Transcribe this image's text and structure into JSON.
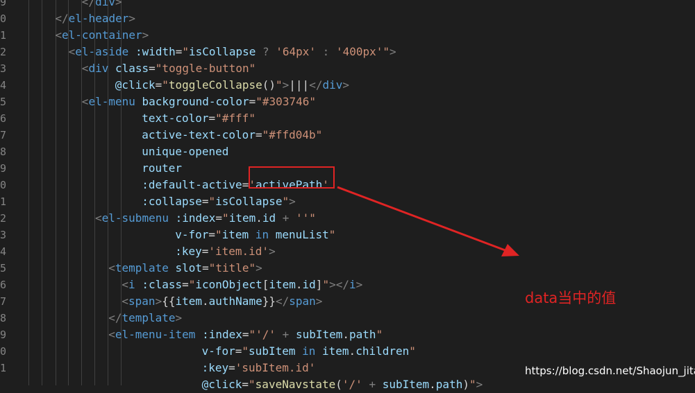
{
  "line_numbers": [
    "9",
    "0",
    "1",
    "2",
    "3",
    "4",
    "5",
    "6",
    "7",
    "8",
    "9",
    "0",
    "1",
    "2",
    "3",
    "4",
    "5",
    "6",
    "7",
    "8",
    "9",
    "0",
    "1"
  ],
  "code_lines": [
    {
      "indent": 6,
      "tokens": [
        {
          "t": "</",
          "c": "punct"
        },
        {
          "t": "div",
          "c": "tag"
        },
        {
          "t": ">",
          "c": "punct"
        }
      ]
    },
    {
      "indent": 4,
      "tokens": [
        {
          "t": "</",
          "c": "punct"
        },
        {
          "t": "el-header",
          "c": "tag"
        },
        {
          "t": ">",
          "c": "punct"
        }
      ]
    },
    {
      "indent": 4,
      "tokens": [
        {
          "t": "<",
          "c": "punct"
        },
        {
          "t": "el-container",
          "c": "tag"
        },
        {
          "t": ">",
          "c": "punct"
        }
      ]
    },
    {
      "indent": 5,
      "tokens": [
        {
          "t": "<",
          "c": "punct"
        },
        {
          "t": "el-aside",
          "c": "tag"
        },
        {
          "t": " ",
          "c": "plain"
        },
        {
          "t": ":width",
          "c": "bind"
        },
        {
          "t": "=",
          "c": "plain"
        },
        {
          "t": "\"",
          "c": "str"
        },
        {
          "t": "isCollapse",
          "c": "attr"
        },
        {
          "t": " ? ",
          "c": "punct"
        },
        {
          "t": "'64px'",
          "c": "str"
        },
        {
          "t": " : ",
          "c": "punct"
        },
        {
          "t": "'400px'",
          "c": "str"
        },
        {
          "t": "\"",
          "c": "str"
        },
        {
          "t": ">",
          "c": "punct"
        }
      ]
    },
    {
      "indent": 6,
      "tokens": [
        {
          "t": "<",
          "c": "punct"
        },
        {
          "t": "div",
          "c": "tag"
        },
        {
          "t": " ",
          "c": "plain"
        },
        {
          "t": "class",
          "c": "attr"
        },
        {
          "t": "=",
          "c": "plain"
        },
        {
          "t": "\"toggle-button\"",
          "c": "str"
        }
      ]
    },
    {
      "indent": 8.5,
      "tokens": [
        {
          "t": "@click",
          "c": "bind"
        },
        {
          "t": "=",
          "c": "plain"
        },
        {
          "t": "\"",
          "c": "str"
        },
        {
          "t": "toggleCollapse",
          "c": "func"
        },
        {
          "t": "()",
          "c": "plain"
        },
        {
          "t": "\"",
          "c": "str"
        },
        {
          "t": ">",
          "c": "punct"
        },
        {
          "t": "|||",
          "c": "plain"
        },
        {
          "t": "</",
          "c": "punct"
        },
        {
          "t": "div",
          "c": "tag"
        },
        {
          "t": ">",
          "c": "punct"
        }
      ]
    },
    {
      "indent": 6,
      "tokens": [
        {
          "t": "<",
          "c": "punct"
        },
        {
          "t": "el-menu",
          "c": "tag"
        },
        {
          "t": " ",
          "c": "plain"
        },
        {
          "t": "background-color",
          "c": "attr"
        },
        {
          "t": "=",
          "c": "plain"
        },
        {
          "t": "\"#303746\"",
          "c": "str"
        }
      ]
    },
    {
      "indent": 10.5,
      "tokens": [
        {
          "t": "text-color",
          "c": "attr"
        },
        {
          "t": "=",
          "c": "plain"
        },
        {
          "t": "\"#fff\"",
          "c": "str"
        }
      ]
    },
    {
      "indent": 10.5,
      "tokens": [
        {
          "t": "active-text-color",
          "c": "attr"
        },
        {
          "t": "=",
          "c": "plain"
        },
        {
          "t": "\"#ffd04b\"",
          "c": "str"
        }
      ]
    },
    {
      "indent": 10.5,
      "tokens": [
        {
          "t": "unique-opened",
          "c": "attr"
        }
      ]
    },
    {
      "indent": 10.5,
      "tokens": [
        {
          "t": "router",
          "c": "attr"
        }
      ]
    },
    {
      "indent": 10.5,
      "tokens": [
        {
          "t": ":default-active",
          "c": "bind"
        },
        {
          "t": "=",
          "c": "plain"
        },
        {
          "t": "'",
          "c": "str"
        },
        {
          "t": "activePath",
          "c": "attr"
        },
        {
          "t": "'",
          "c": "str"
        }
      ]
    },
    {
      "indent": 10.5,
      "tokens": [
        {
          "t": ":collapse",
          "c": "bind"
        },
        {
          "t": "=",
          "c": "plain"
        },
        {
          "t": "\"",
          "c": "str"
        },
        {
          "t": "isCollapse",
          "c": "attr"
        },
        {
          "t": "\"",
          "c": "str"
        },
        {
          "t": ">",
          "c": "punct"
        }
      ]
    },
    {
      "indent": 7,
      "tokens": [
        {
          "t": "<",
          "c": "punct"
        },
        {
          "t": "el-submenu",
          "c": "tag"
        },
        {
          "t": " ",
          "c": "plain"
        },
        {
          "t": ":index",
          "c": "bind"
        },
        {
          "t": "=",
          "c": "plain"
        },
        {
          "t": "\"",
          "c": "str"
        },
        {
          "t": "item",
          "c": "attr"
        },
        {
          "t": ".",
          "c": "plain"
        },
        {
          "t": "id",
          "c": "attr"
        },
        {
          "t": " + ",
          "c": "punct"
        },
        {
          "t": "''",
          "c": "str"
        },
        {
          "t": "\"",
          "c": "str"
        }
      ]
    },
    {
      "indent": 13,
      "tokens": [
        {
          "t": "v-for",
          "c": "bind"
        },
        {
          "t": "=",
          "c": "plain"
        },
        {
          "t": "\"",
          "c": "str"
        },
        {
          "t": "item",
          "c": "attr"
        },
        {
          "t": " in ",
          "c": "kw"
        },
        {
          "t": "menuList",
          "c": "attr"
        },
        {
          "t": "\"",
          "c": "str"
        }
      ]
    },
    {
      "indent": 13,
      "tokens": [
        {
          "t": ":key",
          "c": "bind"
        },
        {
          "t": "=",
          "c": "plain"
        },
        {
          "t": "'item.id'",
          "c": "str"
        },
        {
          "t": ">",
          "c": "punct"
        }
      ]
    },
    {
      "indent": 8,
      "tokens": [
        {
          "t": "<",
          "c": "punct"
        },
        {
          "t": "template",
          "c": "tag"
        },
        {
          "t": " ",
          "c": "plain"
        },
        {
          "t": "slot",
          "c": "attr"
        },
        {
          "t": "=",
          "c": "plain"
        },
        {
          "t": "\"title\"",
          "c": "str"
        },
        {
          "t": ">",
          "c": "punct"
        }
      ]
    },
    {
      "indent": 9,
      "tokens": [
        {
          "t": "<",
          "c": "punct"
        },
        {
          "t": "i",
          "c": "tag"
        },
        {
          "t": " ",
          "c": "plain"
        },
        {
          "t": ":class",
          "c": "bind"
        },
        {
          "t": "=",
          "c": "plain"
        },
        {
          "t": "\"",
          "c": "str"
        },
        {
          "t": "iconObject",
          "c": "attr"
        },
        {
          "t": "[",
          "c": "plain"
        },
        {
          "t": "item",
          "c": "attr"
        },
        {
          "t": ".",
          "c": "plain"
        },
        {
          "t": "id",
          "c": "attr"
        },
        {
          "t": "]",
          "c": "plain"
        },
        {
          "t": "\"",
          "c": "str"
        },
        {
          "t": "></",
          "c": "punct"
        },
        {
          "t": "i",
          "c": "tag"
        },
        {
          "t": ">",
          "c": "punct"
        }
      ]
    },
    {
      "indent": 9,
      "tokens": [
        {
          "t": "<",
          "c": "punct"
        },
        {
          "t": "span",
          "c": "tag"
        },
        {
          "t": ">",
          "c": "punct"
        },
        {
          "t": "{{",
          "c": "plain"
        },
        {
          "t": "item",
          "c": "attr"
        },
        {
          "t": ".",
          "c": "plain"
        },
        {
          "t": "authName",
          "c": "attr"
        },
        {
          "t": "}}",
          "c": "plain"
        },
        {
          "t": "</",
          "c": "punct"
        },
        {
          "t": "span",
          "c": "tag"
        },
        {
          "t": ">",
          "c": "punct"
        }
      ]
    },
    {
      "indent": 8,
      "tokens": [
        {
          "t": "</",
          "c": "punct"
        },
        {
          "t": "template",
          "c": "tag"
        },
        {
          "t": ">",
          "c": "punct"
        }
      ]
    },
    {
      "indent": 8,
      "tokens": [
        {
          "t": "<",
          "c": "punct"
        },
        {
          "t": "el-menu-item",
          "c": "tag"
        },
        {
          "t": " ",
          "c": "plain"
        },
        {
          "t": ":index",
          "c": "bind"
        },
        {
          "t": "=",
          "c": "plain"
        },
        {
          "t": "\"",
          "c": "str"
        },
        {
          "t": "'/'",
          "c": "str"
        },
        {
          "t": " + ",
          "c": "punct"
        },
        {
          "t": "subItem",
          "c": "attr"
        },
        {
          "t": ".",
          "c": "plain"
        },
        {
          "t": "path",
          "c": "attr"
        },
        {
          "t": "\"",
          "c": "str"
        }
      ]
    },
    {
      "indent": 15,
      "tokens": [
        {
          "t": "v-for",
          "c": "bind"
        },
        {
          "t": "=",
          "c": "plain"
        },
        {
          "t": "\"",
          "c": "str"
        },
        {
          "t": "subItem",
          "c": "attr"
        },
        {
          "t": " in ",
          "c": "kw"
        },
        {
          "t": "item",
          "c": "attr"
        },
        {
          "t": ".",
          "c": "plain"
        },
        {
          "t": "children",
          "c": "attr"
        },
        {
          "t": "\"",
          "c": "str"
        }
      ]
    },
    {
      "indent": 15,
      "tokens": [
        {
          "t": ":key",
          "c": "bind"
        },
        {
          "t": "=",
          "c": "plain"
        },
        {
          "t": "'subItem.id'",
          "c": "str"
        }
      ]
    },
    {
      "indent": 15,
      "tokens": [
        {
          "t": "@click",
          "c": "bind"
        },
        {
          "t": "=",
          "c": "plain"
        },
        {
          "t": "\"",
          "c": "str"
        },
        {
          "t": "saveNavstate",
          "c": "func"
        },
        {
          "t": "(",
          "c": "plain"
        },
        {
          "t": "'/'",
          "c": "str"
        },
        {
          "t": " + ",
          "c": "punct"
        },
        {
          "t": "subItem",
          "c": "attr"
        },
        {
          "t": ".",
          "c": "plain"
        },
        {
          "t": "path",
          "c": "attr"
        },
        {
          "t": ")",
          "c": "plain"
        },
        {
          "t": "\"",
          "c": "str"
        },
        {
          "t": ">",
          "c": "punct"
        }
      ]
    }
  ],
  "annotation": {
    "label": "data当中的值",
    "color": "#e02424"
  },
  "watermark": "https://blog.csdn.net/Shaojun_jita"
}
